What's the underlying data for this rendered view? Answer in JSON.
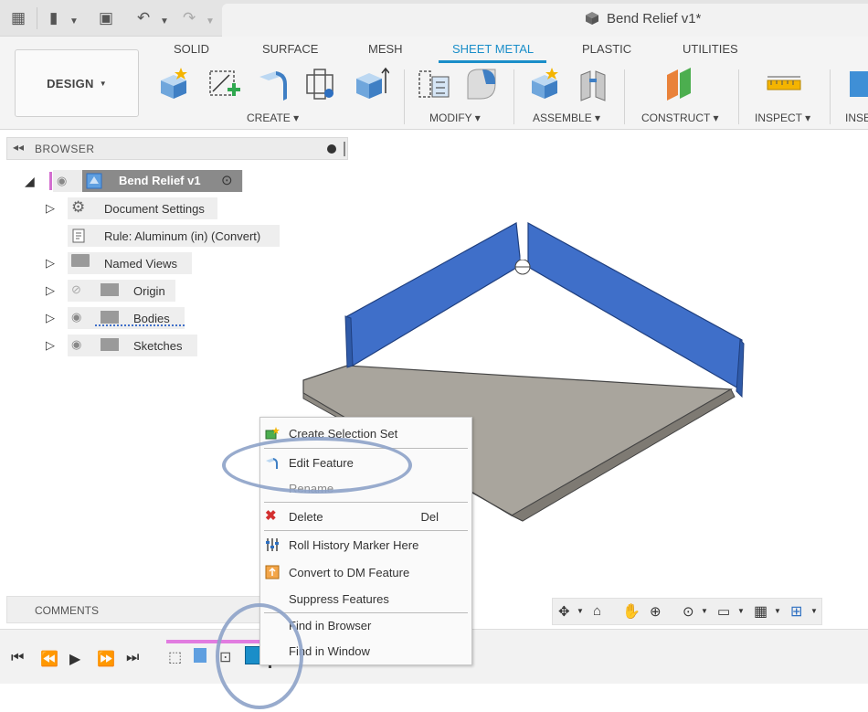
{
  "document": {
    "title": "Bend Relief v1*"
  },
  "workspace": {
    "label": "DESIGN"
  },
  "tabs": [
    {
      "label": "SOLID"
    },
    {
      "label": "SURFACE"
    },
    {
      "label": "MESH"
    },
    {
      "label": "SHEET METAL",
      "active": true
    },
    {
      "label": "PLASTIC"
    },
    {
      "label": "UTILITIES"
    }
  ],
  "groups": [
    {
      "label": "CREATE"
    },
    {
      "label": "MODIFY"
    },
    {
      "label": "ASSEMBLE"
    },
    {
      "label": "CONSTRUCT"
    },
    {
      "label": "INSPECT"
    },
    {
      "label": "INSE"
    }
  ],
  "browser": {
    "title": "BROWSER",
    "root": "Bend Relief v1",
    "items": [
      {
        "label": "Document Settings"
      },
      {
        "label": "Rule: Aluminum (in) (Convert)"
      },
      {
        "label": "Named Views"
      },
      {
        "label": "Origin"
      },
      {
        "label": "Bodies"
      },
      {
        "label": "Sketches"
      }
    ]
  },
  "comments": {
    "label": "COMMENTS"
  },
  "context_menu": {
    "items": [
      {
        "label": "Create Selection Set",
        "icon": "selection-set-icon"
      },
      {
        "label": "Edit Feature",
        "icon": "flange-icon"
      },
      {
        "label": "Rename",
        "dim": true
      },
      {
        "label": "Delete",
        "icon": "delete-icon",
        "shortcut": "Del"
      },
      {
        "label": "Roll History Marker Here",
        "icon": "history-marker-icon"
      },
      {
        "label": "Convert to DM Feature",
        "icon": "convert-icon"
      },
      {
        "label": "Suppress Features"
      },
      {
        "label": "Find in Browser"
      },
      {
        "label": "Find in Window"
      }
    ]
  },
  "colors": {
    "accent": "#1a8ec9",
    "flange_blue": "#3f6fc9",
    "plate_gray": "#a9a59d",
    "highlight_ring": "#8da2c8"
  }
}
